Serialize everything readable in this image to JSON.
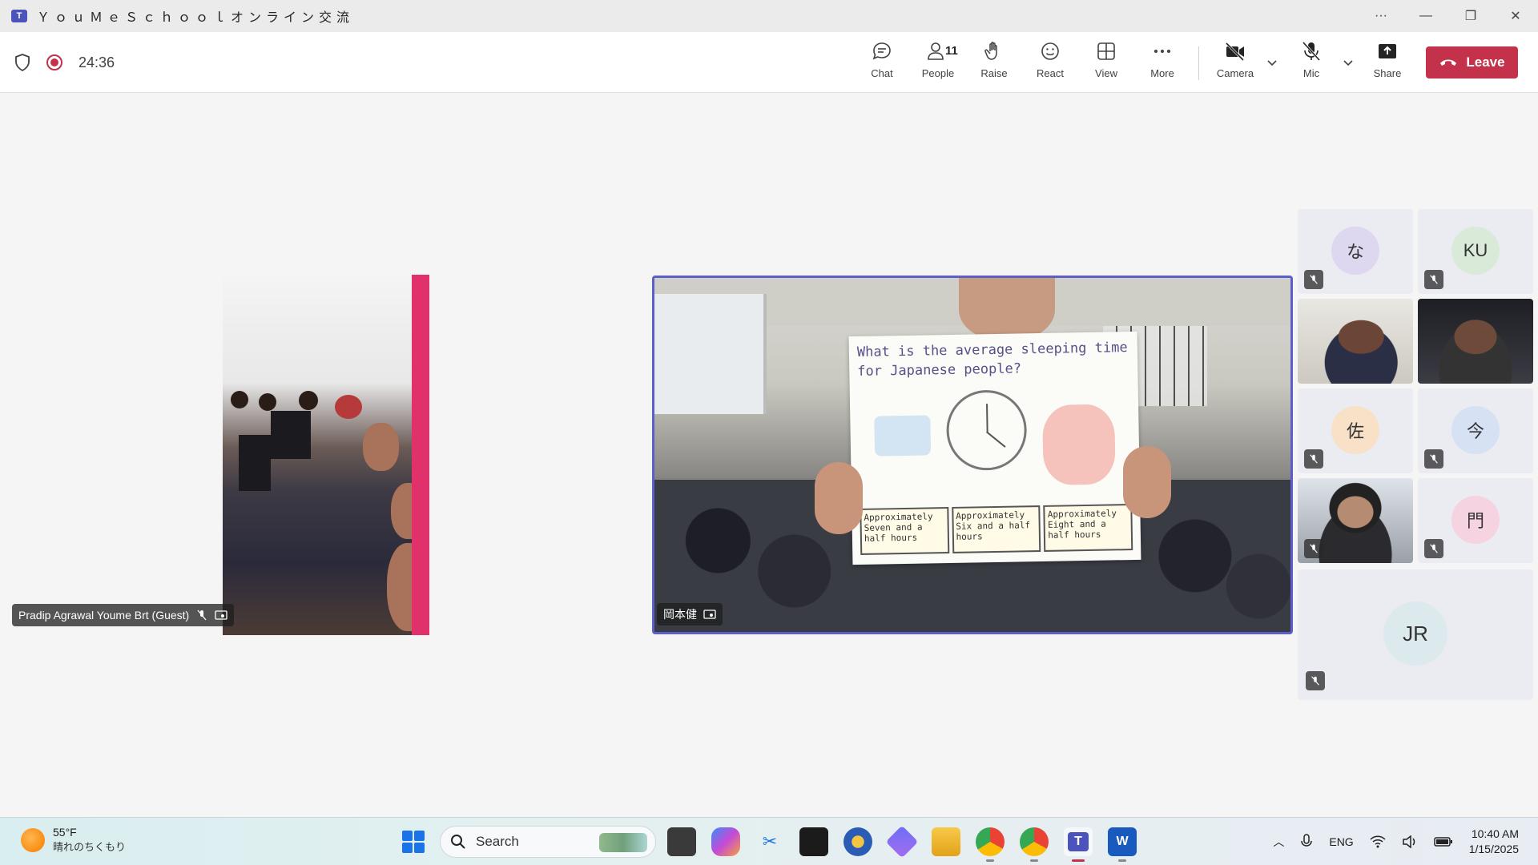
{
  "window": {
    "title": "ＹｏｕＭｅＳｃｈｏｏｌオンライン交流",
    "app_icon": "teams-icon"
  },
  "meeting": {
    "timer": "24:36",
    "recording": true,
    "toolbar": {
      "chat": "Chat",
      "people": "People",
      "people_count": "11",
      "raise": "Raise",
      "react": "React",
      "view": "View",
      "more": "More",
      "camera": "Camera",
      "mic": "Mic",
      "share": "Share",
      "leave": "Leave"
    }
  },
  "participants": {
    "left_tile": {
      "name": "Pradip Agrawal Youme Brt (Guest)"
    },
    "main_tile": {
      "name": "岡本健",
      "poster_question": "What is the average sleeping time for Japanese people?",
      "poster_boxes": [
        "Approximately Seven and a half hours",
        "Approximately Six and a half hours",
        "Approximately Eight and a half hours"
      ]
    },
    "gallery": [
      {
        "initials": "な",
        "color": "#ddd7f0",
        "muted": true
      },
      {
        "initials": "KU",
        "color": "#d9ead9",
        "muted": true
      },
      {
        "initials": "",
        "video": true,
        "muted": false
      },
      {
        "initials": "",
        "video": true,
        "muted": false
      },
      {
        "initials": "佐",
        "color": "#f8e1c6",
        "muted": true
      },
      {
        "initials": "今",
        "color": "#d6e2f3",
        "muted": true
      },
      {
        "initials": "",
        "video": true,
        "muted": true
      },
      {
        "initials": "門",
        "color": "#f6d3e0",
        "muted": true
      },
      {
        "initials": "JR",
        "color": "#dce9ed",
        "muted": true
      }
    ]
  },
  "taskbar": {
    "weather_temp": "55°F",
    "weather_desc": "晴れのちくもり",
    "search_placeholder": "Search",
    "language": "ENG",
    "time": "10:40 AM",
    "date": "1/15/2025"
  }
}
